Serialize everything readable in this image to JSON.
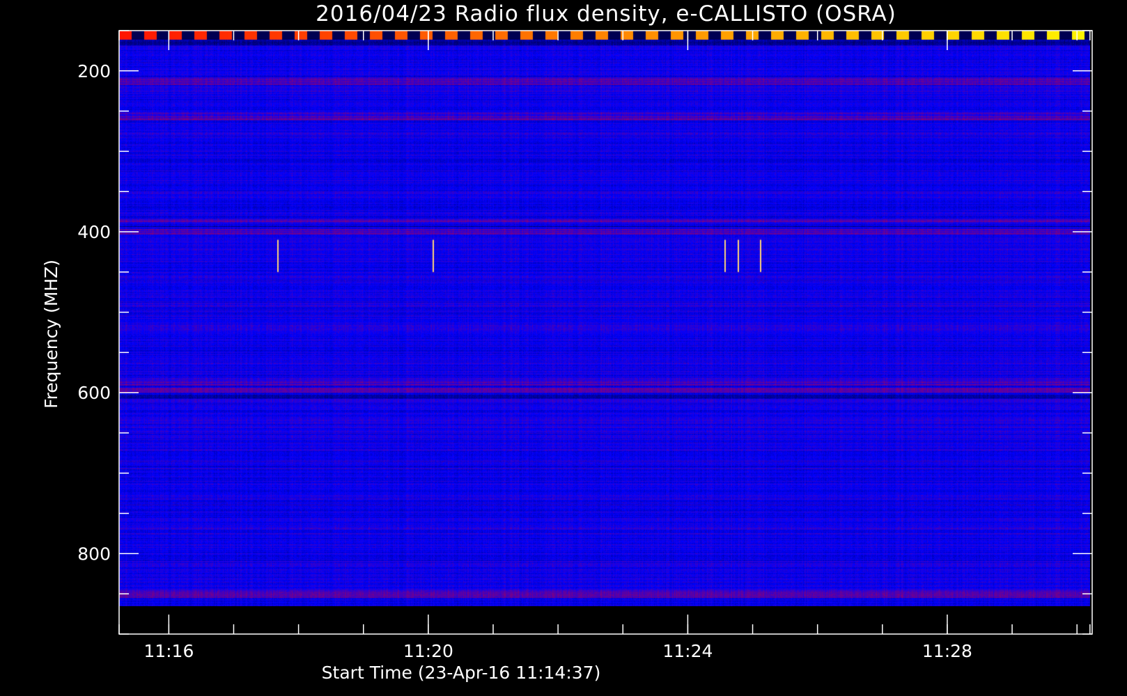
{
  "chart_data": {
    "type": "heatmap",
    "title": "2016/04/23  Radio flux density, e-CALLISTO (OSRA)",
    "xlabel": "Start Time (23-Apr-16 11:14:37)",
    "ylabel": "Frequency (MHZ)",
    "x_ticks": [
      "11:16",
      "11:20",
      "11:24",
      "11:28"
    ],
    "x_tick_minutes": [
      1.383,
      5.383,
      9.383,
      13.383
    ],
    "x_range_minutes": [
      0.617,
      15.617
    ],
    "x_data_range_minutes": [
      0.617,
      15.583
    ],
    "y_ticks": [
      "200",
      "400",
      "600",
      "800"
    ],
    "y_tick_values": [
      200,
      400,
      600,
      800
    ],
    "ylim": [
      150,
      900
    ],
    "y_data_range": [
      150,
      865
    ],
    "y_reversed": true,
    "grid": false,
    "colormap": [
      "#000000",
      "#0000ff",
      "#ff0000",
      "#ffff00",
      "#ffffff"
    ],
    "dark_band_mhz": [
      603,
      690,
      392,
      165
    ],
    "warm_band_mhz": [
      388,
      398,
      586,
      598,
      690,
      256,
      850,
      212
    ],
    "rfi_lines_mhz": [
      155
    ],
    "vertical_spikes_minutes": [
      3.05,
      5.45,
      9.95,
      10.15,
      10.5
    ]
  }
}
